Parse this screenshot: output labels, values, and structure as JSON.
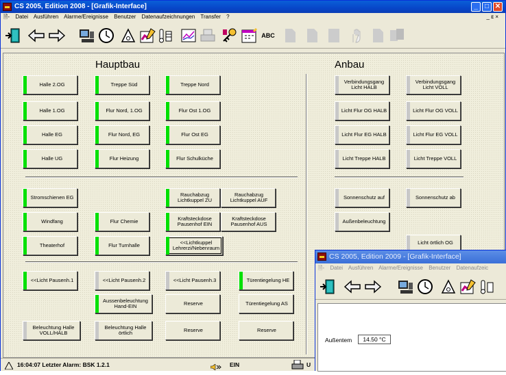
{
  "main_window": {
    "title": "CS 2005, Edition 2008 - [Grafik-Interface]",
    "controls": {
      "minimize": "_",
      "maximize": "□",
      "close": "✕"
    },
    "menu": [
      "Datei",
      "Ausführen",
      "Alarme/Ereignisse",
      "Benutzer",
      "Datenaufzeichnungen",
      "Transfer",
      "?"
    ],
    "mdi_controls": "_ ᴇ ×",
    "toolbar_icons": [
      "exit-door-icon",
      "arrow-left-icon",
      "arrow-right-icon",
      "computer-icon",
      "clock-icon",
      "alarm-bell-icon",
      "edit-chart-icon",
      "thermometer-icon",
      "chart-icon",
      "printer-icon",
      "key-icon",
      "calendar-icon",
      "abc-text-icon",
      "page-icon",
      "page-icon",
      "page-icon",
      "hand-icon",
      "page-icon",
      "pages-icon"
    ],
    "abc_label": "ABC"
  },
  "headings": {
    "hauptbau": "Hauptbau",
    "anbau": "Anbau"
  },
  "buttons": {
    "halle_2og": "Halle 2.OG",
    "treppe_sued": "Treppe Süd",
    "treppe_nord": "Treppe Nord",
    "halle_1og": "Halle 1.OG",
    "flur_nord_1og": "Flur Nord, 1.OG",
    "flur_ost_1og": "Flur Ost 1.OG",
    "halle_eg": "Halle EG",
    "flur_nord_eg": "Flur Nord, EG",
    "flur_ost_eg": "Flur Ost EG",
    "halle_ug": "Halle UG",
    "flur_heizung": "Flur Heizung",
    "flur_schulkueche": "Flur Schulküche",
    "stromschienen_eg": "Stromschienen EG",
    "rauch_zu": "Rauchabzug\nLichtkuppel ZU",
    "rauch_auf": "Rauchabzug\nLichtkuppel AUF",
    "windfang": "Windfang",
    "flur_chemie": "Flur Chemie",
    "kraft_ein": "Kraftsteckdose\nPausenhof EIN",
    "kraft_aus": "Kraftsteckdose\nPausenhof AUS",
    "theaterhof": "Theaterhof",
    "flur_turnhalle": "Flur Turnhalle",
    "lichtkuppel_lehrer": "<<Lichtkuppel\nLehrerzi/Nebenraum",
    "licht_pausenh1": "<<Licht Pausenh.1",
    "licht_pausenh2": "<<Licht Pausenh.2",
    "licht_pausenh3": "<<Licht Pausenh.3",
    "tuer_he": "Türentiegelung HE",
    "aussen_hand": "Aussenbeleuchtung\nHand-EIN",
    "reserve1": "Reserve",
    "tuer_as": "Türentiegelung AS",
    "bel_halle_voll": "Beleuchtung Halle\nVOLL/HALB",
    "bel_halle_oertlich": "Beleuchtung Halle\nörtlich",
    "reserve2": "Reserve",
    "reserve3": "Reserve",
    "verb_halb": "Verbindungsgang\nLicht HALB",
    "verb_voll": "Verbindungsgang\nLicht VOLL",
    "flur_og_halb": "Licht Flur OG  HALB",
    "flur_og_voll": "Licht Flur OG  VOLL",
    "flur_eg_halb": "Licht Flur EG  HALB",
    "flur_eg_voll": "Licht Flur EG  VOLL",
    "treppe_halb": "Licht Treppe  HALB",
    "treppe_voll": "Licht Treppe   VOLL",
    "sonnen_auf": "Sonnenschutz auf",
    "sonnen_ab": "Sonnenschutz ab",
    "aussenbel": "Außenbeleuchtung",
    "licht_oertlich_og": "Licht örtlich OG"
  },
  "status_bar": {
    "alarm_text": "16:04:07 Letzter Alarm: BSK 1.2.1",
    "sound_text": "EIN",
    "user_text": "U"
  },
  "second_window": {
    "title": "CS 2005, Edition 2009 - [Grafik-Interface]",
    "menu": [
      "Datei",
      "Ausführen",
      "Alarme/Ereignisse",
      "Benutzer",
      "Datenaufzeic"
    ],
    "aussentemp_label": "Außentem",
    "aussentemp_value": "14.50 °C"
  },
  "colors": {
    "indicator_on": "#00e000",
    "indicator_off": "#c8c8c8",
    "title_active": "#0a5fd8",
    "title_inactive": "#5c8ee6"
  }
}
